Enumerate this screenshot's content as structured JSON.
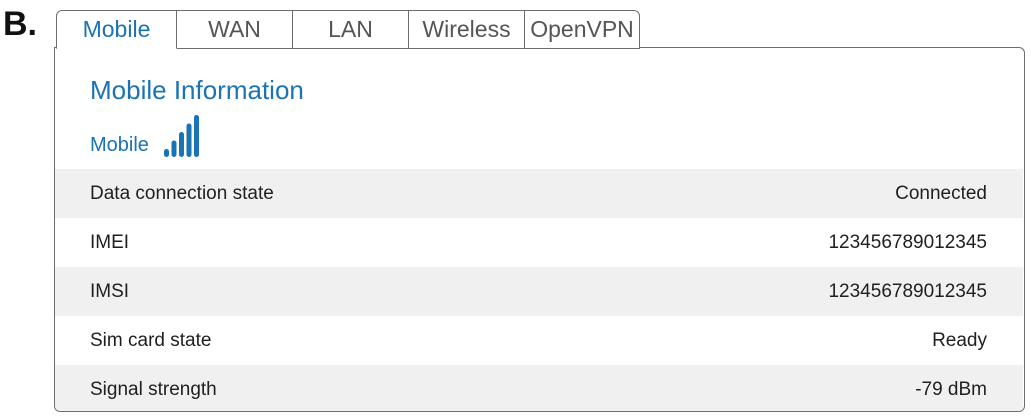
{
  "figure_letter": "B.",
  "tabs": [
    {
      "label": "Mobile",
      "active": true
    },
    {
      "label": "WAN",
      "active": false
    },
    {
      "label": "LAN",
      "active": false
    },
    {
      "label": "Wireless",
      "active": false
    },
    {
      "label": "OpenVPN",
      "active": false
    }
  ],
  "section": {
    "title": "Mobile Information",
    "mobile_label": "Mobile",
    "signal_icon": "signal-bars-icon",
    "signal_bars": 5,
    "signal_bars_filled": 5
  },
  "rows": [
    {
      "label": "Data connection state",
      "value": "Connected"
    },
    {
      "label": "IMEI",
      "value": "123456789012345"
    },
    {
      "label": "IMSI",
      "value": "123456789012345"
    },
    {
      "label": "Sim card state",
      "value": "Ready"
    },
    {
      "label": "Signal strength",
      "value": "-79 dBm"
    }
  ],
  "colors": {
    "accent": "#1a73b5",
    "border": "#6d6d6d",
    "row_alt": "#f0f0f0",
    "text": "#1f1f1f"
  }
}
